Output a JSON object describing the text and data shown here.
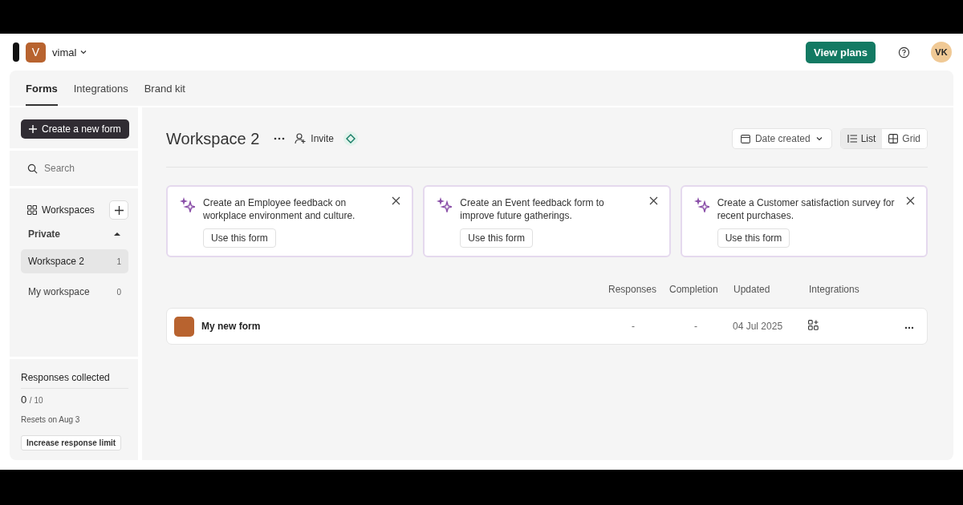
{
  "account": {
    "initial": "V",
    "name": "vimal"
  },
  "header": {
    "plans_button": "View plans",
    "user_initials": "VK"
  },
  "tabs": [
    {
      "label": "Forms",
      "selected": true
    },
    {
      "label": "Integrations",
      "selected": false
    },
    {
      "label": "Brand kit",
      "selected": false
    }
  ],
  "sidebar": {
    "create_button": "Create a new form",
    "search": {
      "placeholder": "Search"
    },
    "workspaces_label": "Workspaces",
    "section": {
      "label": "Private",
      "expanded": true
    },
    "items": [
      {
        "label": "Workspace 2",
        "count": "1",
        "selected": true
      },
      {
        "label": "My workspace",
        "count": "0",
        "selected": false
      }
    ],
    "usage": {
      "title": "Responses collected",
      "used": "0",
      "limit": "/ 10",
      "reset": "Resets on Aug 3",
      "button": "Increase response limit"
    }
  },
  "workspace": {
    "title": "Workspace 2",
    "invite": "Invite",
    "sort": "Date created",
    "views": [
      {
        "label": "List",
        "selected": true
      },
      {
        "label": "Grid",
        "selected": false
      }
    ]
  },
  "suggestions": [
    {
      "text": "Create an Employee feedback on workplace environment and culture.",
      "button": "Use this form"
    },
    {
      "text": "Create an Event feedback form to improve future gatherings.",
      "button": "Use this form"
    },
    {
      "text": "Create a Customer satisfaction survey for recent purchases.",
      "button": "Use this form"
    }
  ],
  "table": {
    "columns": [
      "Responses",
      "Completion",
      "Updated",
      "Integrations"
    ],
    "rows": [
      {
        "name": "My new form",
        "responses": "-",
        "completion": "-",
        "updated": "04 Jul 2025"
      }
    ]
  }
}
